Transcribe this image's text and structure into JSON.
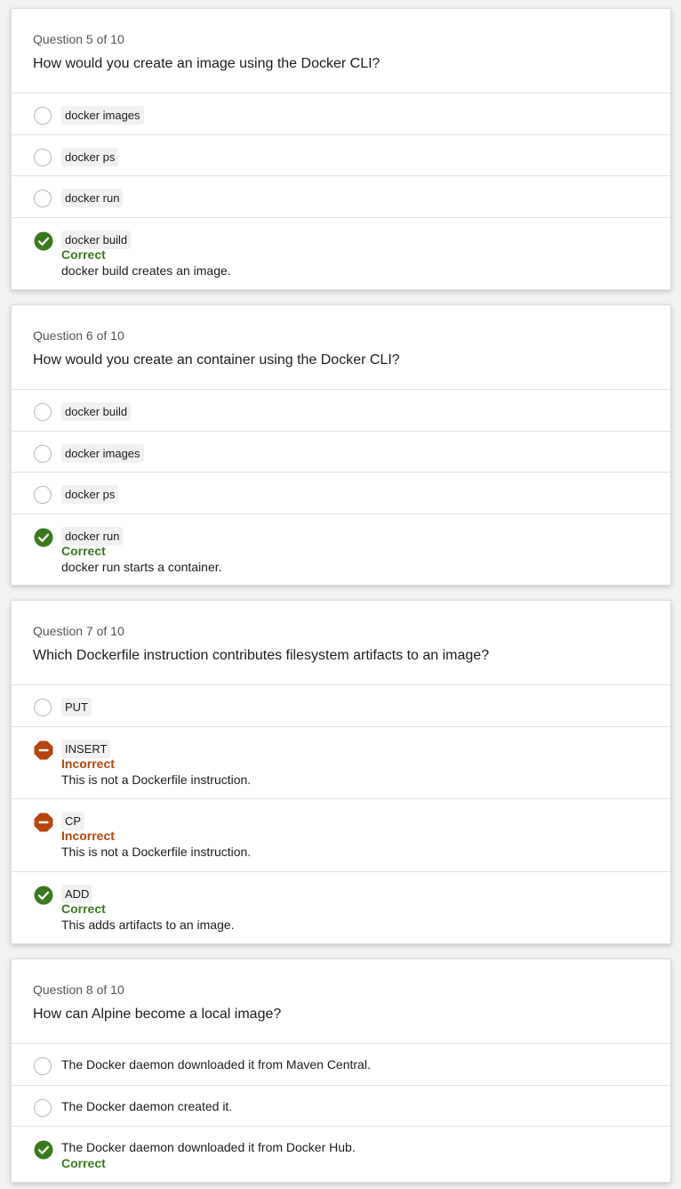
{
  "colors": {
    "correct": "#3a7a1e",
    "incorrect": "#b5460f"
  },
  "questions": [
    {
      "number": "Question 5 of 10",
      "text": "How would you create an image using the Docker CLI?",
      "options": [
        {
          "label": "docker images",
          "style": "code",
          "state": "unselected"
        },
        {
          "label": "docker ps",
          "style": "code",
          "state": "unselected"
        },
        {
          "label": "docker run",
          "style": "code",
          "state": "unselected"
        },
        {
          "label": "docker build",
          "style": "code",
          "state": "correct",
          "icon": "check-circle-icon",
          "feedback": "Correct",
          "explanation": "docker build creates an image."
        }
      ]
    },
    {
      "number": "Question 6 of 10",
      "text": "How would you create an container using the Docker CLI?",
      "options": [
        {
          "label": "docker build",
          "style": "code",
          "state": "unselected"
        },
        {
          "label": "docker images",
          "style": "code",
          "state": "unselected"
        },
        {
          "label": "docker ps",
          "style": "code",
          "state": "unselected"
        },
        {
          "label": "docker run",
          "style": "code",
          "state": "correct",
          "icon": "check-circle-icon",
          "feedback": "Correct",
          "explanation": "docker run starts a container."
        }
      ]
    },
    {
      "number": "Question 7 of 10",
      "text": "Which Dockerfile instruction contributes filesystem artifacts to an image?",
      "options": [
        {
          "label": "PUT",
          "style": "code",
          "state": "unselected"
        },
        {
          "label": "INSERT",
          "style": "code",
          "state": "incorrect",
          "icon": "stop-sign-icon",
          "feedback": "Incorrect",
          "explanation": "This is not a Dockerfile instruction."
        },
        {
          "label": "CP",
          "style": "code",
          "state": "incorrect",
          "icon": "stop-sign-icon",
          "feedback": "Incorrect",
          "explanation": "This is not a Dockerfile instruction."
        },
        {
          "label": "ADD",
          "style": "code",
          "state": "correct",
          "icon": "check-circle-icon",
          "feedback": "Correct",
          "explanation": "This adds artifacts to an image."
        }
      ]
    },
    {
      "number": "Question 8 of 10",
      "text": "How can Alpine become a local image?",
      "options": [
        {
          "label": "The Docker daemon downloaded it from Maven Central.",
          "style": "plain",
          "state": "unselected"
        },
        {
          "label": "The Docker daemon created it.",
          "style": "plain",
          "state": "unselected"
        },
        {
          "label": "The Docker daemon downloaded it from Docker Hub.",
          "style": "plain",
          "state": "correct",
          "icon": "check-circle-icon",
          "feedback": "Correct"
        }
      ]
    }
  ]
}
